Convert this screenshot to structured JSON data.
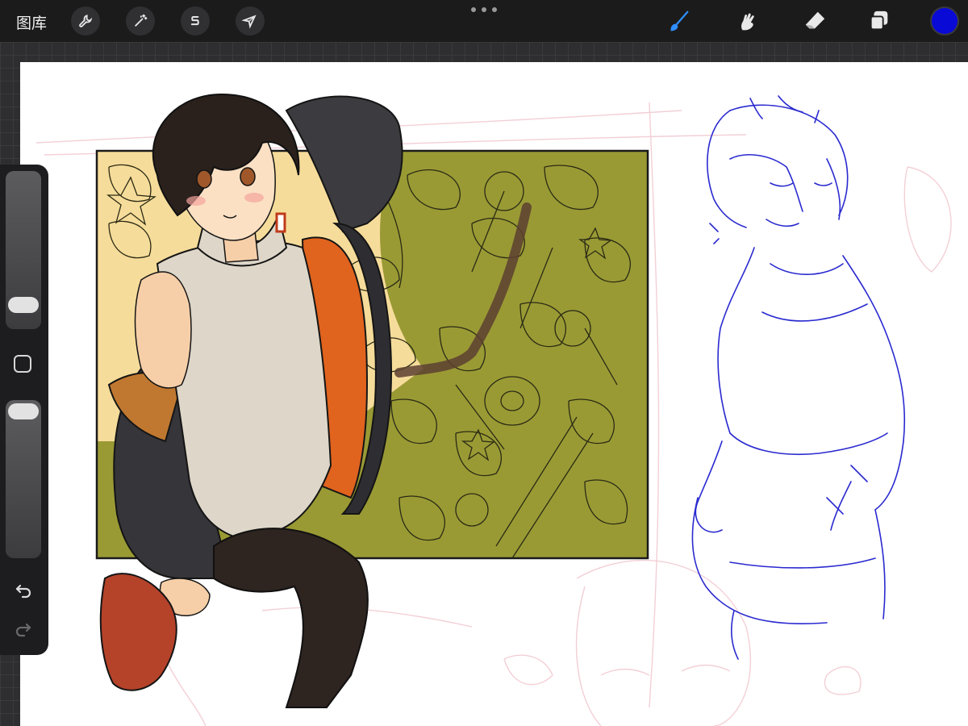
{
  "topbar": {
    "gallery_label": "图库",
    "left_tools": [
      {
        "name": "wrench-icon",
        "role": "actions"
      },
      {
        "name": "magic-wand-icon",
        "role": "adjustments"
      },
      {
        "name": "selection-s-icon",
        "role": "selection"
      },
      {
        "name": "arrow-cursor-icon",
        "role": "transform"
      }
    ],
    "right_tools": [
      {
        "name": "brush-icon",
        "role": "paint",
        "active": true
      },
      {
        "name": "smudge-icon",
        "role": "smudge"
      },
      {
        "name": "eraser-icon",
        "role": "erase"
      },
      {
        "name": "layers-icon",
        "role": "layers"
      }
    ],
    "active_color": "#0a0ad6"
  },
  "sidebar": {
    "brush_size_slider": {
      "level": 0.82
    },
    "opacity_slider": {
      "level": 0.0
    },
    "icons": [
      "undo-icon",
      "redo-icon",
      "modify-square-icon"
    ]
  },
  "colors": {
    "accent_blue": "#2f8fff",
    "sketch_blue": "#2a2ad0",
    "panel_yellow": "#f6dc9a",
    "panel_olive": "#9a9a35",
    "toolbar_bg": "#1b1b1c"
  }
}
